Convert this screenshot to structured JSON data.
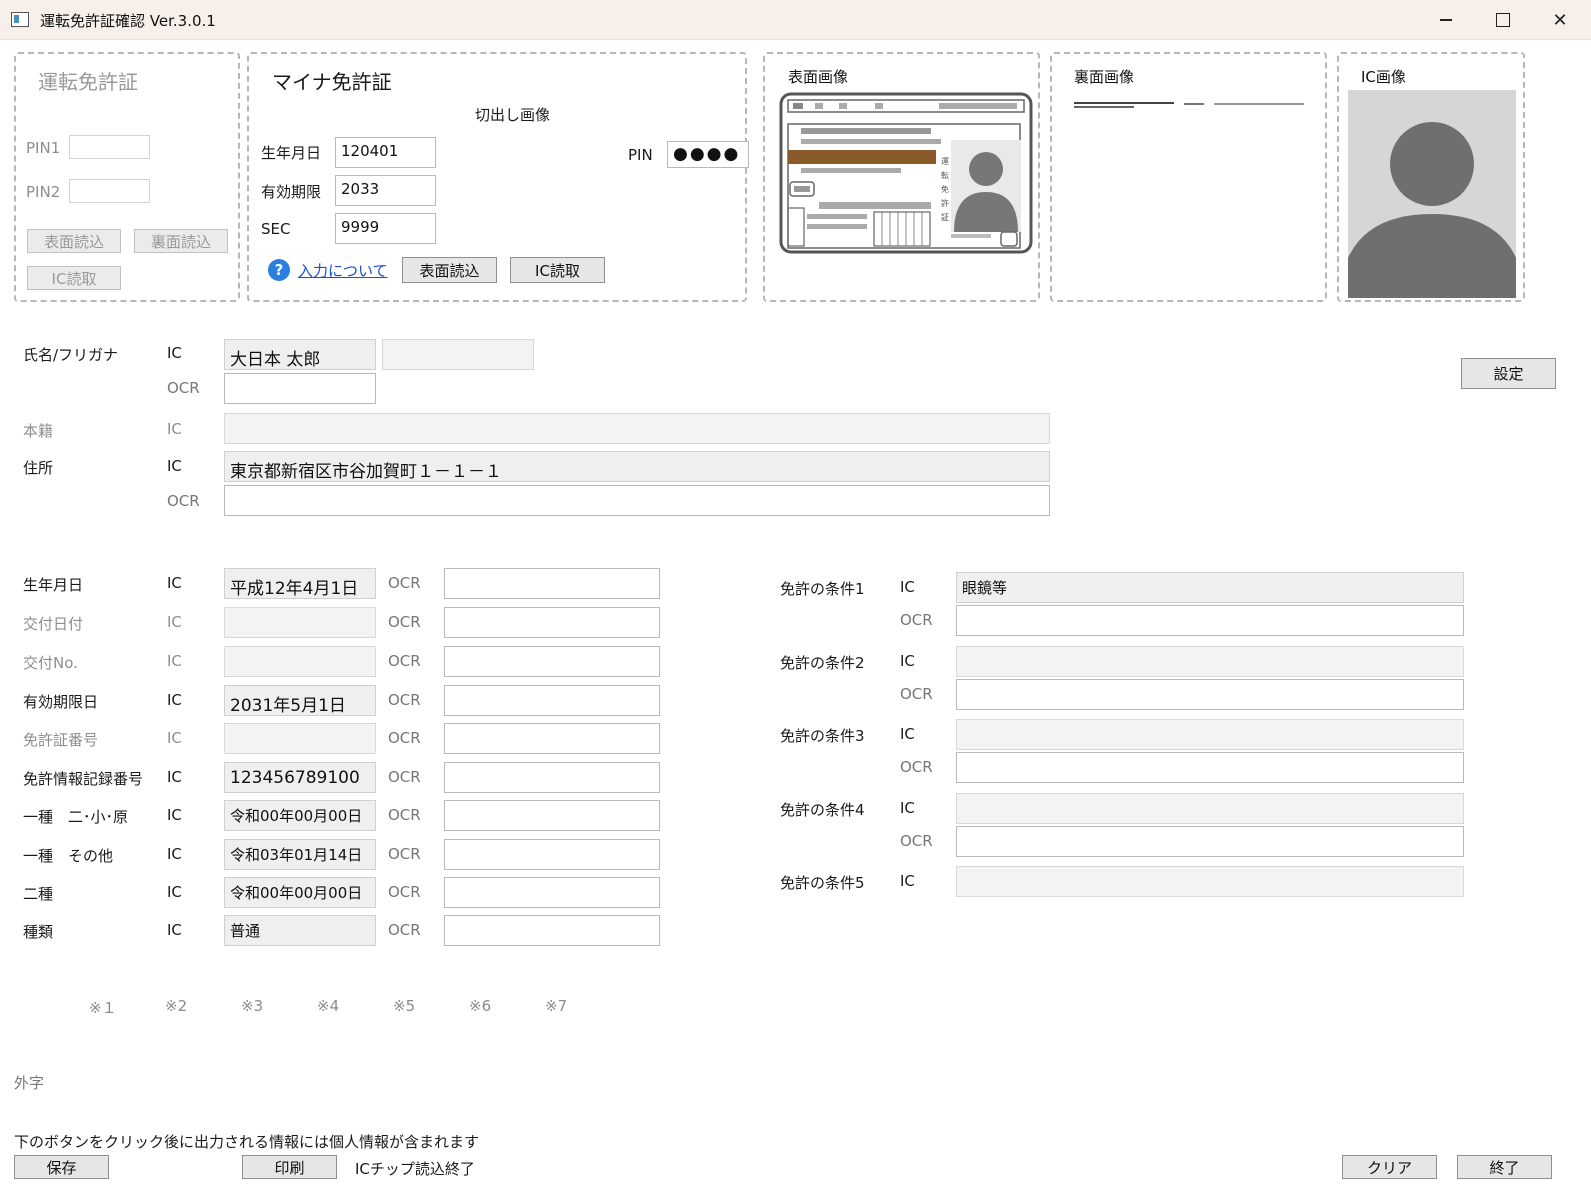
{
  "window": {
    "title": "運転免許証確認 Ver.3.0.1",
    "close_glyph": "✕"
  },
  "license_panel": {
    "title": "運転免許証",
    "pin1_label": "PIN1",
    "pin2_label": "PIN2",
    "front_read_button": "表面読込",
    "back_read_button": "裏面読込",
    "ic_read_button": "IC読取"
  },
  "myna_panel": {
    "title": "マイナ免許証",
    "crop_label": "切出し画像",
    "birth_label": "生年月日",
    "birth_value": "120401",
    "expiry_label": "有効期限",
    "expiry_value": "2033",
    "sec_label": "SEC",
    "sec_value": "9999",
    "pin_label": "PIN",
    "pin_value": "●●●●",
    "help_glyph": "?",
    "help_link": "入力について",
    "front_read_button": "表面読込",
    "ic_read_button": "IC読取"
  },
  "images": {
    "front_title": "表面画像",
    "back_title": "裏面画像",
    "ic_title": "IC画像"
  },
  "settings_button": "設定",
  "fields": {
    "name_label": "氏名/フリガナ",
    "name_ic": "大日本 太郎",
    "name_kana": "",
    "honseki_label": "本籍",
    "address_label": "住所",
    "address_ic": "東京都新宿区市谷加賀町１－１－１",
    "ic": "IC",
    "ocr": "OCR"
  },
  "left_rows": [
    {
      "label": "生年月日",
      "ic": "平成12年4月1日",
      "enabled": true,
      "big": true
    },
    {
      "label": "交付日付",
      "ic": "",
      "enabled": false,
      "big": false
    },
    {
      "label": "交付No.",
      "ic": "",
      "enabled": false,
      "big": false
    },
    {
      "label": "有効期限日",
      "ic": "2031年5月1日",
      "enabled": true,
      "big": true
    },
    {
      "label": "免許証番号",
      "ic": "",
      "enabled": false,
      "big": false
    },
    {
      "label": "免許情報記録番号",
      "ic": "123456789100",
      "enabled": true,
      "big": true
    },
    {
      "label": "一種　二･小･原",
      "ic": "令和00年00月00日",
      "enabled": true,
      "big": false
    },
    {
      "label": "一種　その他",
      "ic": "令和03年01月14日",
      "enabled": true,
      "big": false
    },
    {
      "label": "二種",
      "ic": "令和00年00月00日",
      "enabled": true,
      "big": false
    },
    {
      "label": "種類",
      "ic": "普通",
      "enabled": true,
      "big": false
    }
  ],
  "conditions": [
    {
      "label": "免許の条件1",
      "ic": "眼鏡等",
      "has_ocr": true
    },
    {
      "label": "免許の条件2",
      "ic": "",
      "has_ocr": true
    },
    {
      "label": "免許の条件3",
      "ic": "",
      "has_ocr": true
    },
    {
      "label": "免許の条件4",
      "ic": "",
      "has_ocr": true
    },
    {
      "label": "免許の条件5",
      "ic": "",
      "has_ocr": false
    }
  ],
  "notes": [
    "※１",
    "※2",
    "※3",
    "※4",
    "※5",
    "※6",
    "※7"
  ],
  "gaiji_label": "外字",
  "footer": {
    "warning": "下のボタンをクリック後に出力される情報には個人情報が含まれます",
    "save_button": "保存",
    "print_button": "印刷",
    "status": "ICチップ読込終了",
    "clear_button": "クリア",
    "exit_button": "終了"
  }
}
